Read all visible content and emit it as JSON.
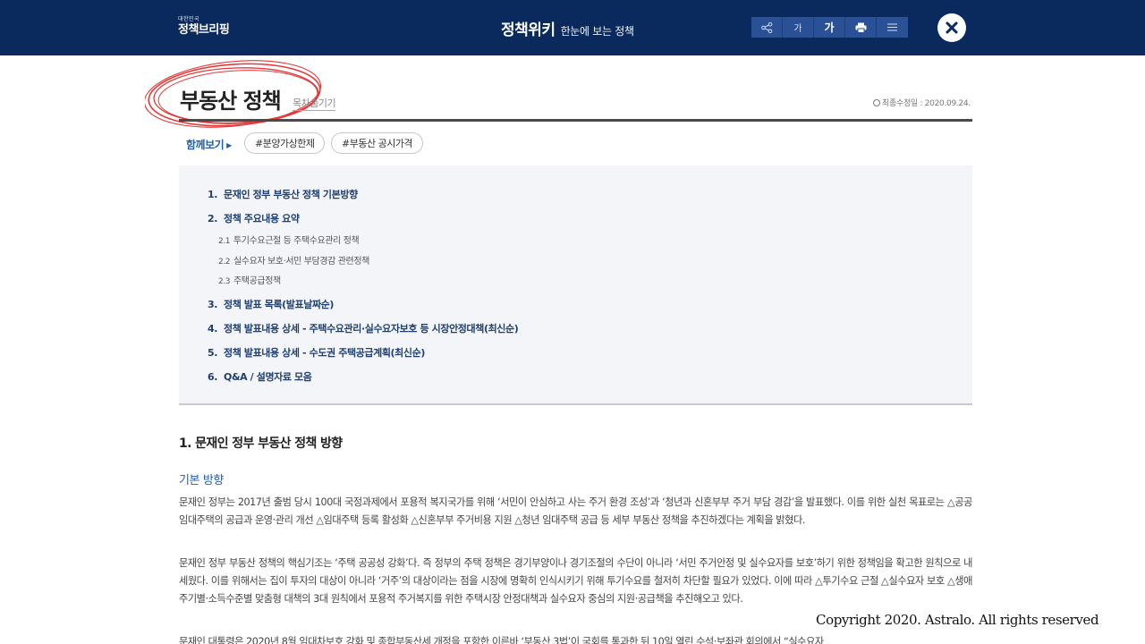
{
  "header": {
    "logo_small": "대한민국",
    "logo_big": "정책브리핑",
    "title": "정책위키",
    "subtitle": "한눈에 보는 정책",
    "tools": {
      "share_icon": "share-icon",
      "font_small": "가",
      "font_large": "가",
      "print_icon": "print-icon",
      "menu_icon": "menu-icon",
      "close_icon": "close-icon"
    }
  },
  "page": {
    "title": "부동산 정책",
    "toc_toggle": "목차숨기기",
    "last_updated": "최종수정일 : 2020.09.24."
  },
  "see_also": {
    "label": "함께보기",
    "tags": [
      "#분양가상한제",
      "#부동산 공시가격"
    ]
  },
  "toc": {
    "items": [
      {
        "num": "1.",
        "label": "문재인 정부 부동산 정책 기본방향"
      },
      {
        "num": "2.",
        "label": "정책 주요내용 요약"
      },
      {
        "num": "3.",
        "label": "정책 발표 목록(발표날짜순)"
      },
      {
        "num": "4.",
        "label": "정책 발표내용 상세 - 주택수요관리·실수요자보호 등 시장안정대책(최신순)"
      },
      {
        "num": "5.",
        "label": "정책 발표내용 상세 - 수도권 주택공급계획(최신순)"
      },
      {
        "num": "6.",
        "label": "Q&A / 설명자료 모음"
      }
    ],
    "subitems": [
      {
        "num": "2.1",
        "label": "투기수요근절 등 주택수요관리 정책"
      },
      {
        "num": "2.2",
        "label": "실수요자 보호·서민 부담경감 관련정책"
      },
      {
        "num": "2.3",
        "label": "주택공급정책"
      }
    ]
  },
  "content": {
    "section_heading": "1. 문재인 정부 부동산 정책 방향",
    "sub_heading": "기본 방향",
    "paragraphs": [
      "문재인 정부는 2017년 출범 당시 100대 국정과제에서 포용적 복지국가를 위해 ‘서민이 안심하고 사는 주거 환경 조성’과 ‘청년과 신혼부부 주거 부담 경감’을 발표했다. 이를 위한 실천 목표로는 △공공임대주택의 공급과 운영·관리 개선 △임대주택 등록 활성화 △신혼부부 주거비용 지원 △청년 임대주택 공급 등 세부 부동산 정책을 추진하겠다는 계획을 밝혔다.",
      "문재인 정부 부동산 정책의 핵심기조는 ‘주택 공공성 강화’다. 즉 정부의 주택 정책은 경기부양이나 경기조절의 수단이 아니라 ‘서민 주거안정 및 실수요자를 보호’하기 위한 정책임을 확고한 원칙으로 내세웠다. 이를 위해서는 집이 투자의 대상이 아니라 ‘거주’의 대상이라는 점을 시장에 명확히 인식시키기 위해 투기수요를 철저히 차단할 필요가 있었다. 이에 따라 △투기수요 근절 △실수요자 보호 △생애주기별·소득수준별 맞춤형 대책의 3대 원칙에서 포용적 주거복지를 위한 주택시장 안정대책과 실수요자 중심의 지원·공급책을 추진해오고 있다.",
      "문재인 대통령은 2020년 8월 임대차보호 강화 및 종합부동산세 개정을 포함한 이른바 ‘부동산 3법’이 국회를 통과한 뒤 10일 열린 수석·보좌관 회의에서 “실수요자"
    ]
  },
  "footer": {
    "copyright": "Copyright 2020. Astralo. All rights reserved"
  },
  "colors": {
    "header_bg": "#0a2a5e",
    "tool_bg": "#2a5096",
    "accent_blue": "#1f5fae",
    "toc_text": "#1f3f73",
    "circle_red": "#e03a3a"
  }
}
